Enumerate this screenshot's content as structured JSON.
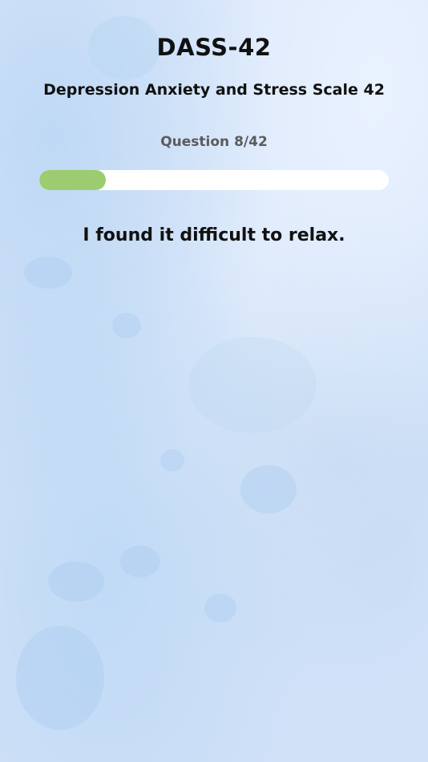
{
  "app": {
    "title": "DASS-42",
    "subtitle": "Depression Anxiety and Stress Scale 42"
  },
  "progress": {
    "label": "Question 8/42",
    "current": 8,
    "total": 42,
    "fraction": 0.19047619
  },
  "question": {
    "text": "I found it difficult to relax."
  },
  "colors": {
    "background": "#d6e6fb",
    "progress_fill": "#9ccc6f",
    "progress_track": "#ffffff",
    "text_primary": "#111111",
    "text_secondary": "#5b5b5b"
  }
}
